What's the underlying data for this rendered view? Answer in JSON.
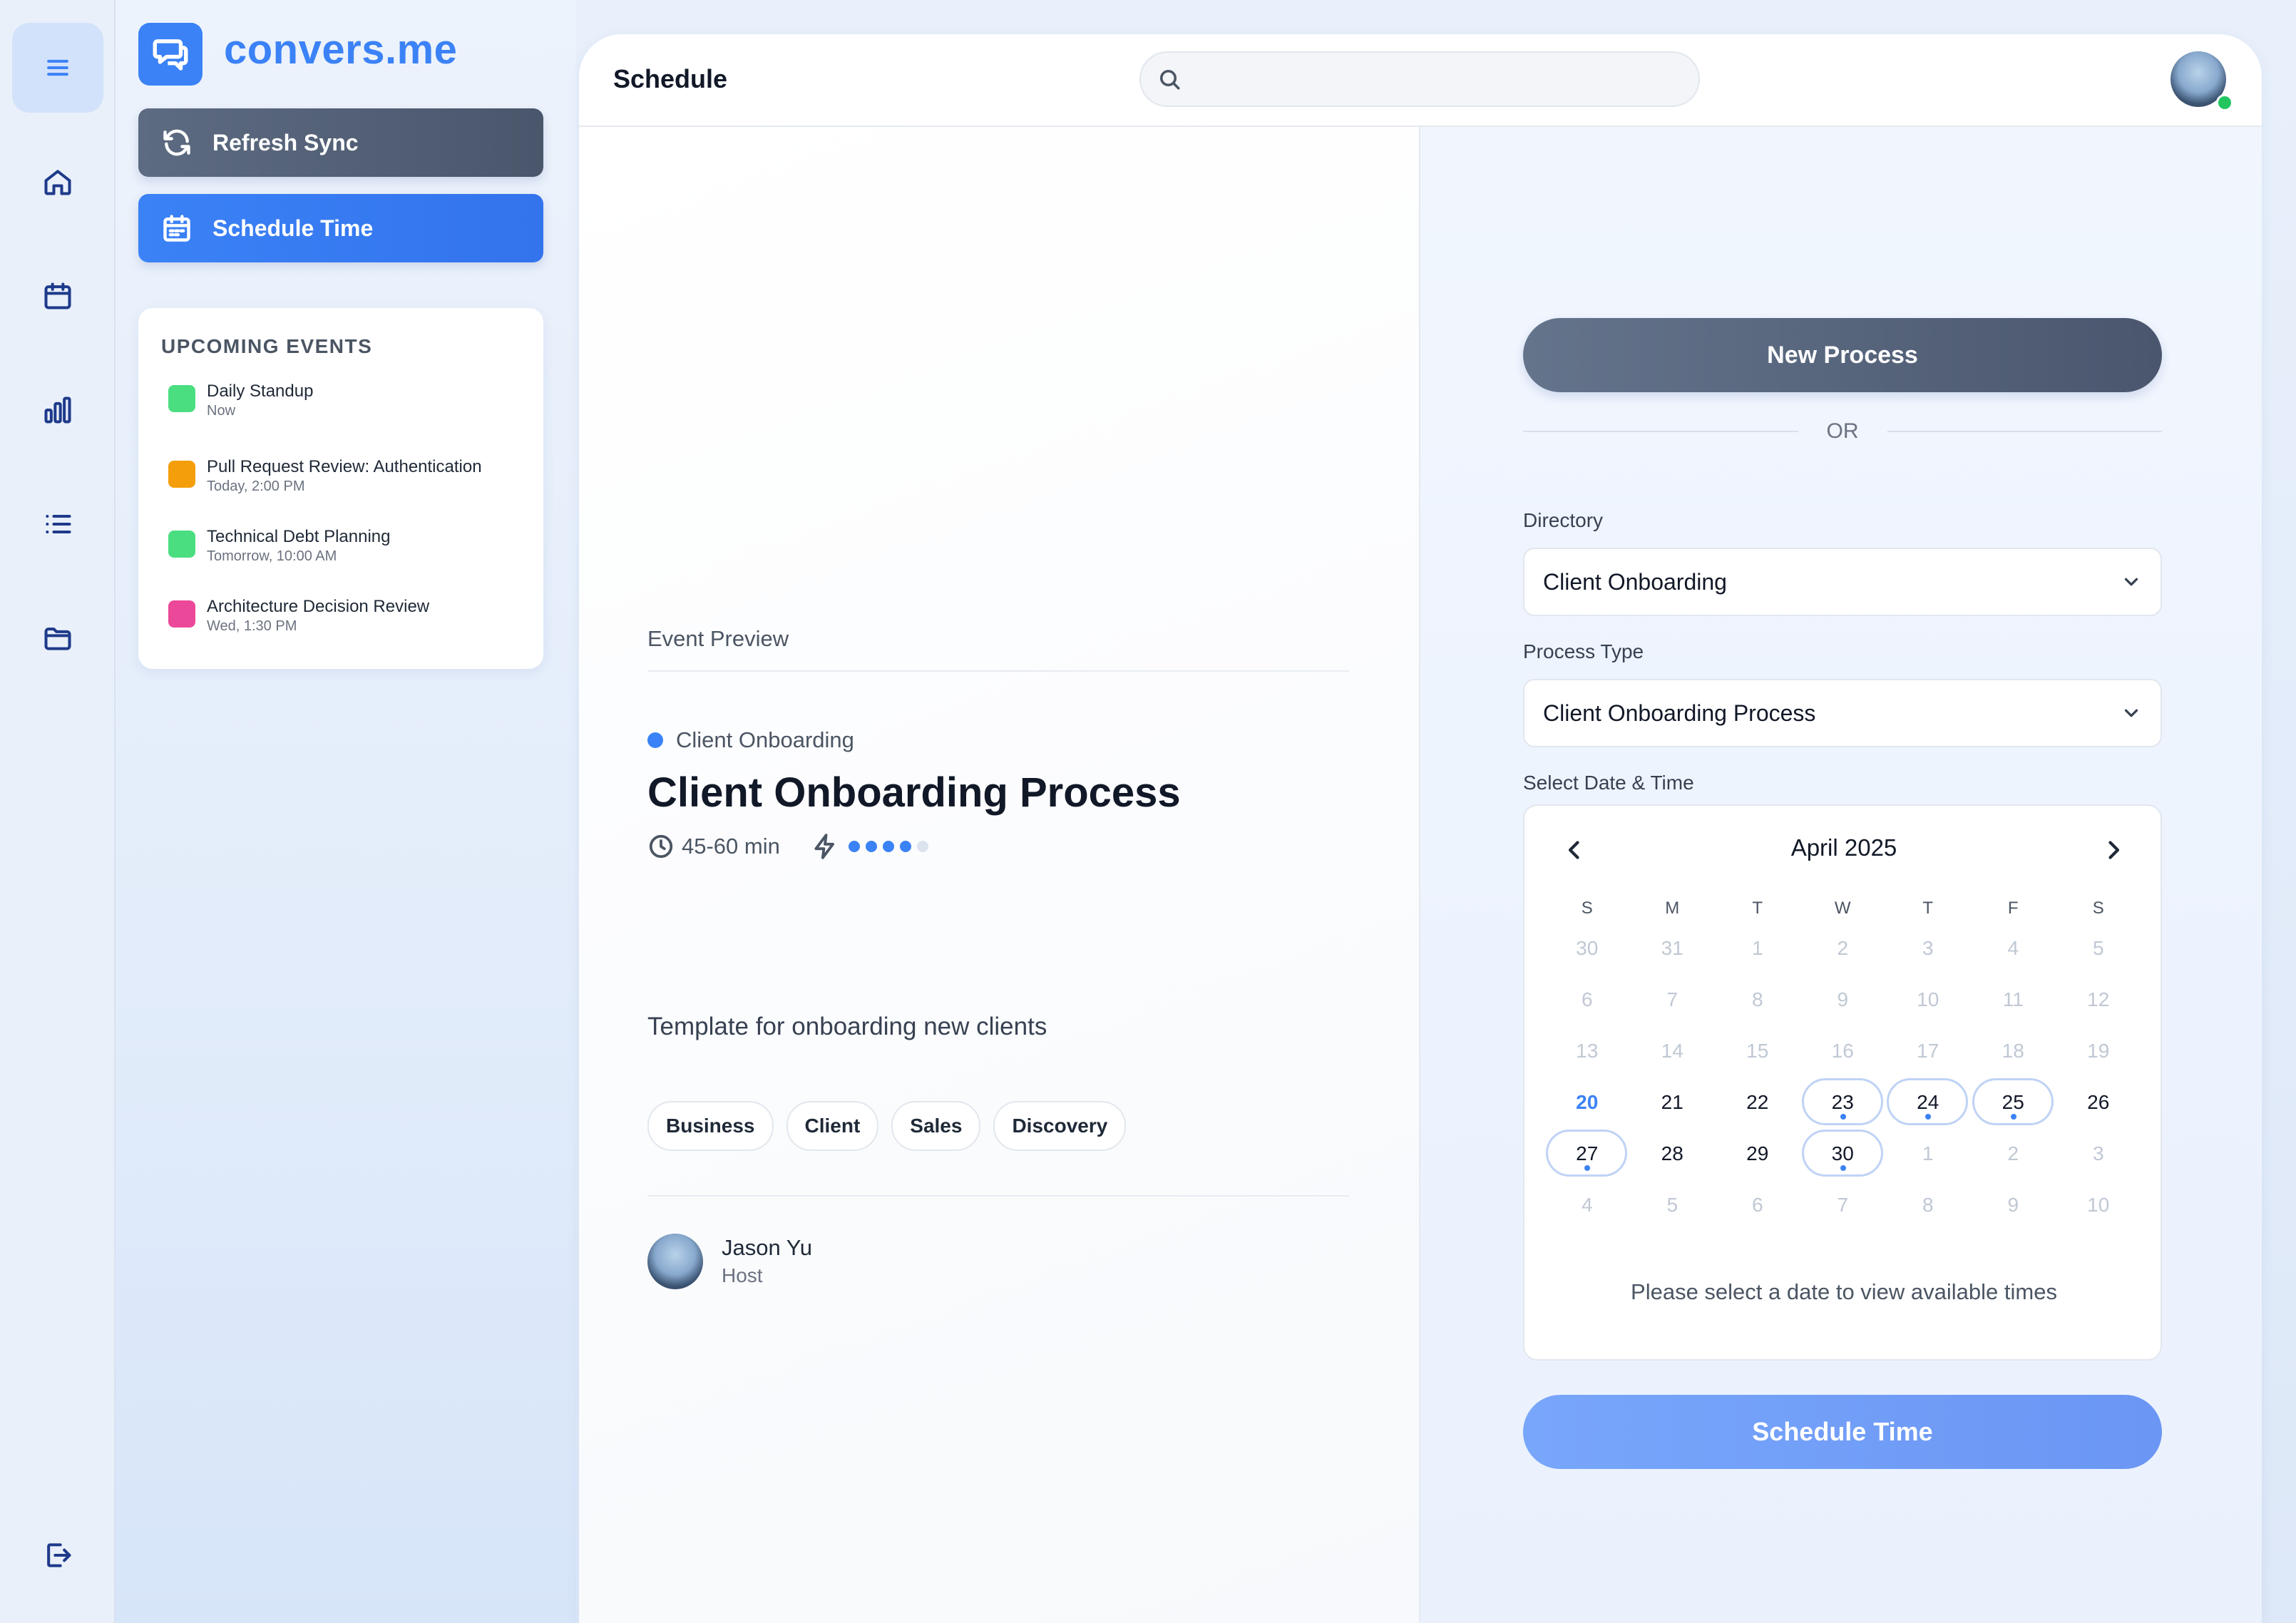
{
  "app": {
    "name": "convers.me"
  },
  "rail": {
    "icons": [
      "menu-icon",
      "home-icon",
      "calendar-icon",
      "bar-chart-icon",
      "list-icon",
      "folder-icon",
      "logout-icon"
    ]
  },
  "sidebar": {
    "refresh_label": "Refresh Sync",
    "schedule_label": "Schedule Time",
    "upcoming_title": "UPCOMING EVENTS",
    "events": [
      {
        "name": "Daily Standup",
        "time": "Now",
        "color": "#4ade80"
      },
      {
        "name": "Pull Request Review: Authentication",
        "time": "Today, 2:00 PM",
        "color": "#f59e0b"
      },
      {
        "name": "Technical Debt Planning",
        "time": "Tomorrow, 10:00 AM",
        "color": "#4ade80"
      },
      {
        "name": "Architecture Decision Review",
        "time": "Wed, 1:30 PM",
        "color": "#ec4899"
      }
    ]
  },
  "header": {
    "title": "Schedule",
    "search_value": "",
    "search_placeholder": ""
  },
  "preview": {
    "label": "Event Preview",
    "category": "Client Onboarding",
    "title": "Client Onboarding Process",
    "duration": "45-60 min",
    "complexity": 4,
    "complexity_max": 5,
    "description": "Template for onboarding new clients",
    "tags": [
      "Business",
      "Client",
      "Sales",
      "Discovery"
    ],
    "host": {
      "name": "Jason Yu",
      "role": "Host"
    }
  },
  "form": {
    "new_process_label": "New Process",
    "or_label": "OR",
    "directory_label": "Directory",
    "directory_value": "Client Onboarding",
    "process_type_label": "Process Type",
    "process_type_value": "Client Onboarding Process",
    "date_time_label": "Select Date & Time",
    "schedule_label": "Schedule Time",
    "calendar": {
      "month": "April 2025",
      "weekdays": [
        "S",
        "M",
        "T",
        "W",
        "T",
        "F",
        "S"
      ],
      "weeks": [
        [
          {
            "d": "30",
            "m": true
          },
          {
            "d": "31",
            "m": true
          },
          {
            "d": "1",
            "m": true
          },
          {
            "d": "2",
            "m": true
          },
          {
            "d": "3",
            "m": true
          },
          {
            "d": "4",
            "m": true
          },
          {
            "d": "5",
            "m": true
          }
        ],
        [
          {
            "d": "6",
            "m": true
          },
          {
            "d": "7",
            "m": true
          },
          {
            "d": "8",
            "m": true
          },
          {
            "d": "9",
            "m": true
          },
          {
            "d": "10",
            "m": true
          },
          {
            "d": "11",
            "m": true
          },
          {
            "d": "12",
            "m": true
          }
        ],
        [
          {
            "d": "13",
            "m": true
          },
          {
            "d": "14",
            "m": true
          },
          {
            "d": "15",
            "m": true
          },
          {
            "d": "16",
            "m": true
          },
          {
            "d": "17",
            "m": true
          },
          {
            "d": "18",
            "m": true
          },
          {
            "d": "19",
            "m": true
          }
        ],
        [
          {
            "d": "20",
            "today": true
          },
          {
            "d": "21"
          },
          {
            "d": "22"
          },
          {
            "d": "23",
            "avail": true
          },
          {
            "d": "24",
            "avail": true
          },
          {
            "d": "25",
            "avail": true
          },
          {
            "d": "26"
          }
        ],
        [
          {
            "d": "27",
            "avail": true
          },
          {
            "d": "28"
          },
          {
            "d": "29"
          },
          {
            "d": "30",
            "avail": true
          },
          {
            "d": "1",
            "m": true
          },
          {
            "d": "2",
            "m": true
          },
          {
            "d": "3",
            "m": true
          }
        ],
        [
          {
            "d": "4",
            "m": true
          },
          {
            "d": "5",
            "m": true
          },
          {
            "d": "6",
            "m": true
          },
          {
            "d": "7",
            "m": true
          },
          {
            "d": "8",
            "m": true
          },
          {
            "d": "9",
            "m": true
          },
          {
            "d": "10",
            "m": true
          }
        ]
      ],
      "note": "Please select a date to view available times"
    }
  }
}
